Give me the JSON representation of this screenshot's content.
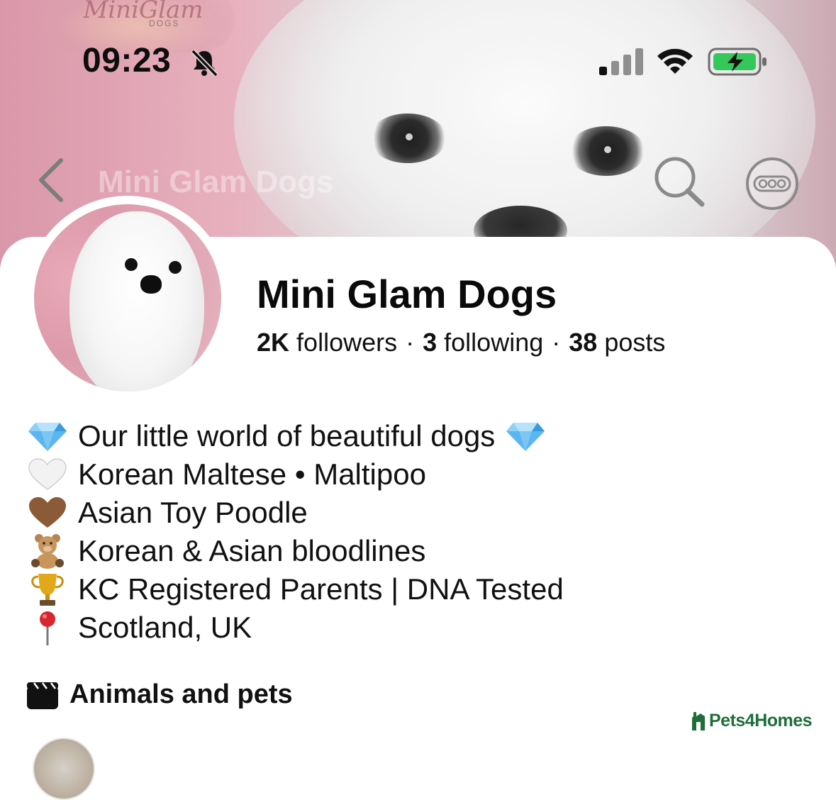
{
  "cover": {
    "logo_text": "MiniGlam",
    "logo_sub": "DOGS"
  },
  "status_bar": {
    "time": "09:23",
    "icons": [
      "bell-slash-icon",
      "cellular-signal-icon",
      "wifi-icon",
      "battery-charging-icon"
    ],
    "battery_color": "#34c759"
  },
  "nav": {
    "back_icon": "chevron-left-icon",
    "title": "Mini Glam Dogs",
    "search_icon": "search-icon",
    "more_icon": "more-icon"
  },
  "profile": {
    "name": "Mini Glam Dogs",
    "stats": {
      "followers_count": "2K",
      "followers_label": "followers",
      "following_count": "3",
      "following_label": "following",
      "posts_count": "38",
      "posts_label": "posts",
      "separator": "·"
    },
    "bio": [
      {
        "emoji": "gem-icon",
        "text": "Our little world of beautiful dogs"
      },
      {
        "emoji": "white-heart-icon",
        "text": "Korean Maltese • Maltipoo"
      },
      {
        "emoji": "brown-heart-icon",
        "text": "Asian Toy Poodle"
      },
      {
        "emoji": "teddy-bear-icon",
        "text": "Korean & Asian bloodlines"
      },
      {
        "emoji": "trophy-icon",
        "text": "KC Registered Parents | DNA Tested"
      },
      {
        "emoji": "round-pushpin-icon",
        "text": "Scotland, UK"
      }
    ],
    "category": {
      "icon": "clapper-board-icon",
      "label": "Animals and pets"
    }
  },
  "watermark": {
    "text": "Pets4Homes",
    "color": "#1f6e3a"
  }
}
